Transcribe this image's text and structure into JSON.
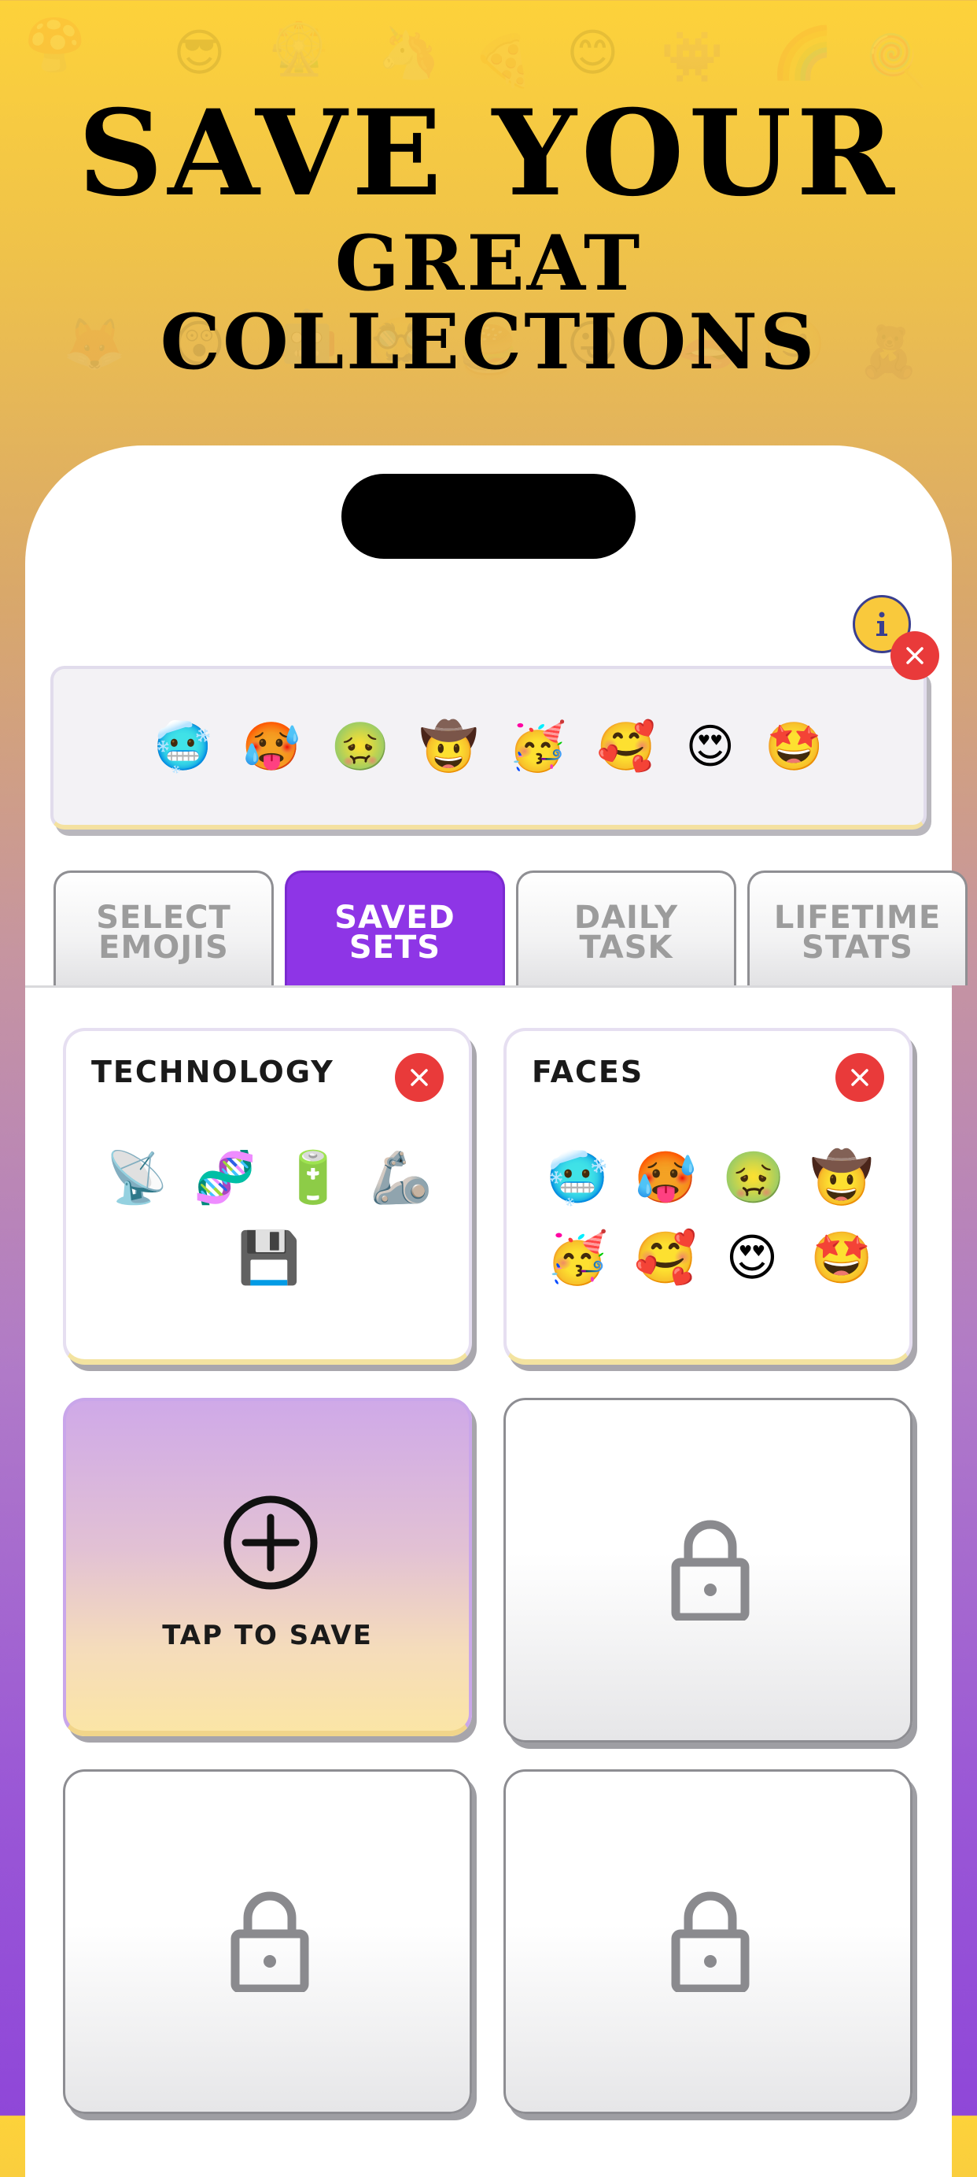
{
  "headline": {
    "line1": "SAVE YOUR",
    "line2": "GREAT COLLECTIONS"
  },
  "preview": {
    "emojis": [
      "🥶",
      "🥵",
      "🤢",
      "🤠",
      "🥳",
      "🥰",
      "😍",
      "🤩"
    ]
  },
  "tabs": [
    {
      "label": "SELECT\nEMOJIS",
      "active": false
    },
    {
      "label": "SAVED\nSETS",
      "active": true
    },
    {
      "label": "DAILY\nTASK",
      "active": false
    },
    {
      "label": "LIFETIME\nSTATS",
      "active": false
    }
  ],
  "saved_sets": [
    {
      "title": "TECHNOLOGY",
      "emojis": [
        "📡",
        "🧬",
        "🔋",
        "🦾",
        "💾"
      ]
    },
    {
      "title": "FACES",
      "emojis": [
        "🥶",
        "🥵",
        "🤢",
        "🤠",
        "🥳",
        "🥰",
        "😍",
        "🤩"
      ]
    }
  ],
  "add_card": {
    "label": "TAP TO SAVE"
  },
  "icons": {
    "info": "info-icon",
    "close": "close-icon",
    "add": "plus-circle-icon",
    "lock": "lock-icon"
  },
  "colors": {
    "accent": "#8e35e6",
    "close": "#e93a3a",
    "info": "#f9c93c"
  }
}
